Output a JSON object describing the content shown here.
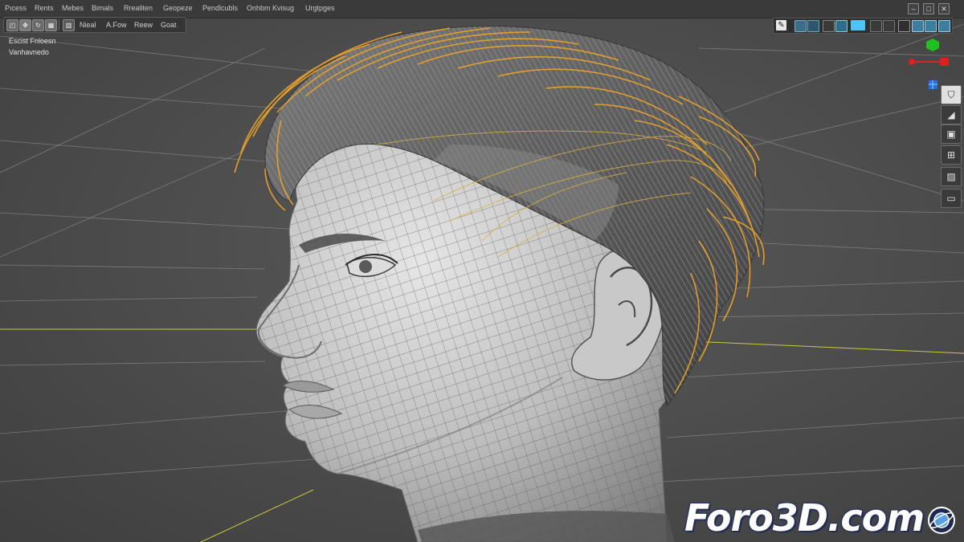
{
  "menubar": {
    "items": [
      "Pıcess",
      "Rents",
      "Mebes",
      "Bimals",
      "Rrealiten",
      "Geopeze",
      "Pendlcubls",
      "Onhbm Kvisug",
      "Urgtpges"
    ]
  },
  "window_controls": {
    "minimize": "–",
    "maximize": "□",
    "close": "✕"
  },
  "toolbar": {
    "labels": [
      "Nieal",
      "A.Fow",
      "Reew",
      "Goat"
    ]
  },
  "viewport_info": {
    "line1": "Escist Fnloesn",
    "line2": "Vanhavnedo"
  },
  "colors": {
    "hair_guide": "#e8a22c",
    "grid_line": "#b8b8b8",
    "axis_yellow": "#d8d83a",
    "gizmo_x": "#e02020",
    "gizmo_y": "#20c020",
    "gizmo_z": "#2070e0",
    "icon_active": "#4fc3f7"
  },
  "icons": {
    "toolbar": [
      "select-icon",
      "move-icon",
      "rotate-icon",
      "scale-icon"
    ],
    "right_sidebar": [
      "vertex-icon",
      "brush-icon",
      "camera-icon",
      "render-icon",
      "texture-icon",
      "layout-icon"
    ]
  },
  "watermark": {
    "text": "Foro3D.com"
  }
}
